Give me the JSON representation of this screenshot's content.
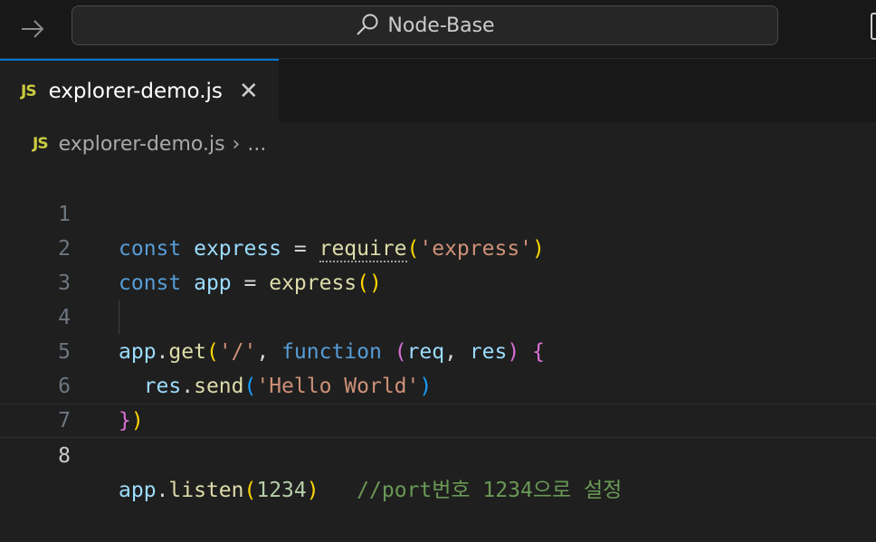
{
  "titlebar": {
    "search_text": "Node-Base"
  },
  "tab": {
    "badge": "JS",
    "label": "explorer-demo.js",
    "close": "✕"
  },
  "breadcrumb": {
    "badge": "JS",
    "file": "explorer-demo.js",
    "separator": "›",
    "more": "..."
  },
  "editor": {
    "line_numbers": [
      "1",
      "2",
      "3",
      "4",
      "5",
      "6",
      "7",
      "8"
    ],
    "active_line": "8",
    "tokens": {
      "l1": [
        "const",
        " express ",
        "=",
        " ",
        "require",
        "(",
        "'express'",
        ")"
      ],
      "l2": [
        "const",
        " app ",
        "=",
        " ",
        "express",
        "(",
        ")"
      ],
      "l4": [
        "app",
        ".",
        "get",
        "(",
        "'/'",
        ", ",
        "function",
        " ",
        "(",
        "req",
        ", ",
        "res",
        ")",
        " ",
        "{"
      ],
      "l5": [
        "  ",
        "res",
        ".",
        "send",
        "(",
        "'Hello World'",
        ")"
      ],
      "l6": [
        "}",
        ")"
      ],
      "l8": [
        "app",
        ".",
        "listen",
        "(",
        "1234",
        ")",
        "   ",
        "//port번호 1234으로 설정"
      ]
    }
  },
  "colors": {
    "accent": "#0078d4",
    "keyword": "#569cd6",
    "string": "#ce9178",
    "comment": "#6a9955",
    "js_badge": "#cbcb41"
  }
}
